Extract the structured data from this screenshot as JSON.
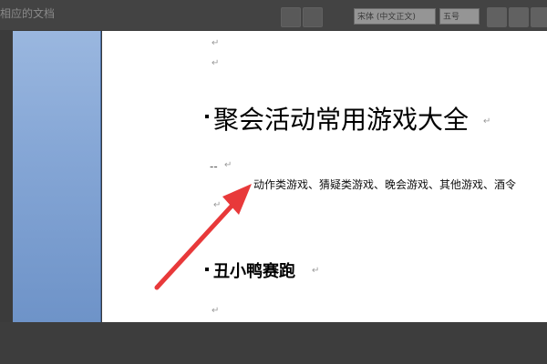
{
  "window": {
    "title": "相应的文档"
  },
  "toolbar": {
    "font_name": "宋体 (中文正文)",
    "font_size": "五号"
  },
  "document": {
    "paragraph_mark": "↵",
    "heading1": "聚会活动常用游戏大全",
    "dashes": "--",
    "summary": "动作类游戏、猜疑类游戏、晚会游戏、其他游戏、酒令",
    "heading2": "丑小鸭赛跑"
  },
  "annotation": {
    "arrow_color": "#e8393a"
  },
  "colors": {
    "nav_panel": "#86a7d6",
    "page": "#ffffff",
    "background": "#3b3b3b"
  }
}
